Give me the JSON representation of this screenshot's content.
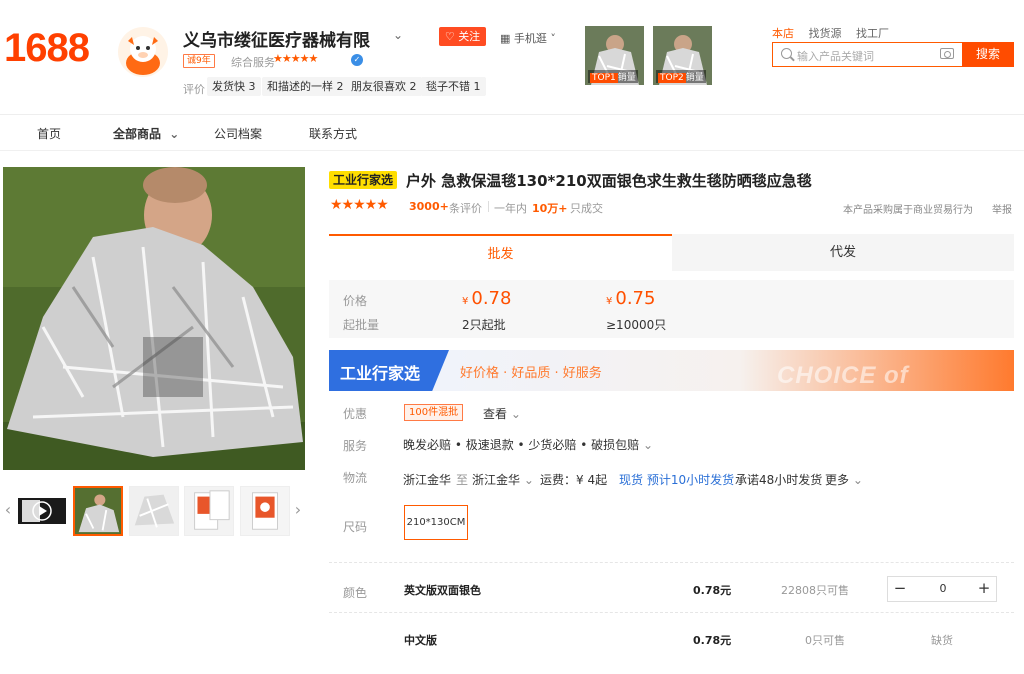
{
  "header": {
    "logo": "1688",
    "shop_name": "义乌市缕征医疗器械有限",
    "follow_label": "关注",
    "mobile_label": "手机逛",
    "years_badge": "诚9年",
    "comp_service_label": "综合服务",
    "comp_stars": "★★★★★",
    "review_label": "评价",
    "review_tags": [
      "发货快 3",
      "和描述的一样 2",
      "朋友很喜欢 2",
      "毯子不错 1"
    ],
    "top_items": [
      {
        "rank": "TOP1",
        "label": "销量"
      },
      {
        "rank": "TOP2",
        "label": "销量"
      }
    ],
    "scope_tabs": [
      "本店",
      "找货源",
      "找工厂"
    ],
    "search_placeholder": "输入产品关键词",
    "search_button": "搜索"
  },
  "nav": {
    "items": [
      "首页",
      "全部商品",
      "公司档案",
      "联系方式"
    ]
  },
  "product": {
    "title_badge": "工业行家选",
    "title": "户外 急救保温毯130*210双面银色求生救生毯防晒毯应急毯",
    "stars": "★★★★★",
    "eval_count": "3000+",
    "eval_label": "条评价",
    "year_label": "一年内",
    "year_count": "10万+",
    "year_unit": "只成交",
    "trade_note": "本产品采购属于商业贸易行为",
    "report": "举报"
  },
  "tabs": {
    "wholesale": "批发",
    "dropship": "代发"
  },
  "price_panel": {
    "price_label": "价格",
    "moq_label": "起批量",
    "currency": "¥",
    "tiers": [
      {
        "price": "0.78",
        "qty": "2只起批"
      },
      {
        "price": "0.75",
        "qty": "≥10000只"
      }
    ]
  },
  "banner": {
    "title": "工业行家选",
    "slogan": "好价格 · 好品质 · 好服务",
    "english": "CHOICE of EXPERT"
  },
  "details": {
    "discount_label": "优惠",
    "discount_tag": "100件混批",
    "view_label": "查看",
    "service_label": "服务",
    "service_text": "晚发必赔 • 极速退款 • 少货必赔 • 破损包赔",
    "logistics_label": "物流",
    "from": "浙江金华",
    "to_word": "至",
    "to": "浙江金华",
    "freight": "运费：¥ 4起",
    "stock_ship": "现货 预计10小时发货",
    "promise": "承诺48小时发货",
    "more": "更多",
    "size_label": "尺码",
    "size_option": "210*130CM"
  },
  "sku": {
    "color_label": "颜色",
    "rows": [
      {
        "name": "英文版双面银色",
        "price": "0.78元",
        "stock": "22808只可售",
        "qty": "0"
      },
      {
        "name": "中文版",
        "price": "0.78元",
        "stock": "0只可售",
        "status": "缺货"
      }
    ]
  },
  "colors": {
    "accent": "#ff5a00",
    "brand": "#ff4000",
    "banner_blue": "#2f6fe0",
    "link_blue": "#2a6fd6"
  },
  "icons": [
    "search-icon",
    "camera-icon",
    "chevron-down-icon",
    "heart-icon",
    "grid-icon",
    "verify-icon",
    "play-icon",
    "arrow-left-icon",
    "arrow-right-icon"
  ]
}
